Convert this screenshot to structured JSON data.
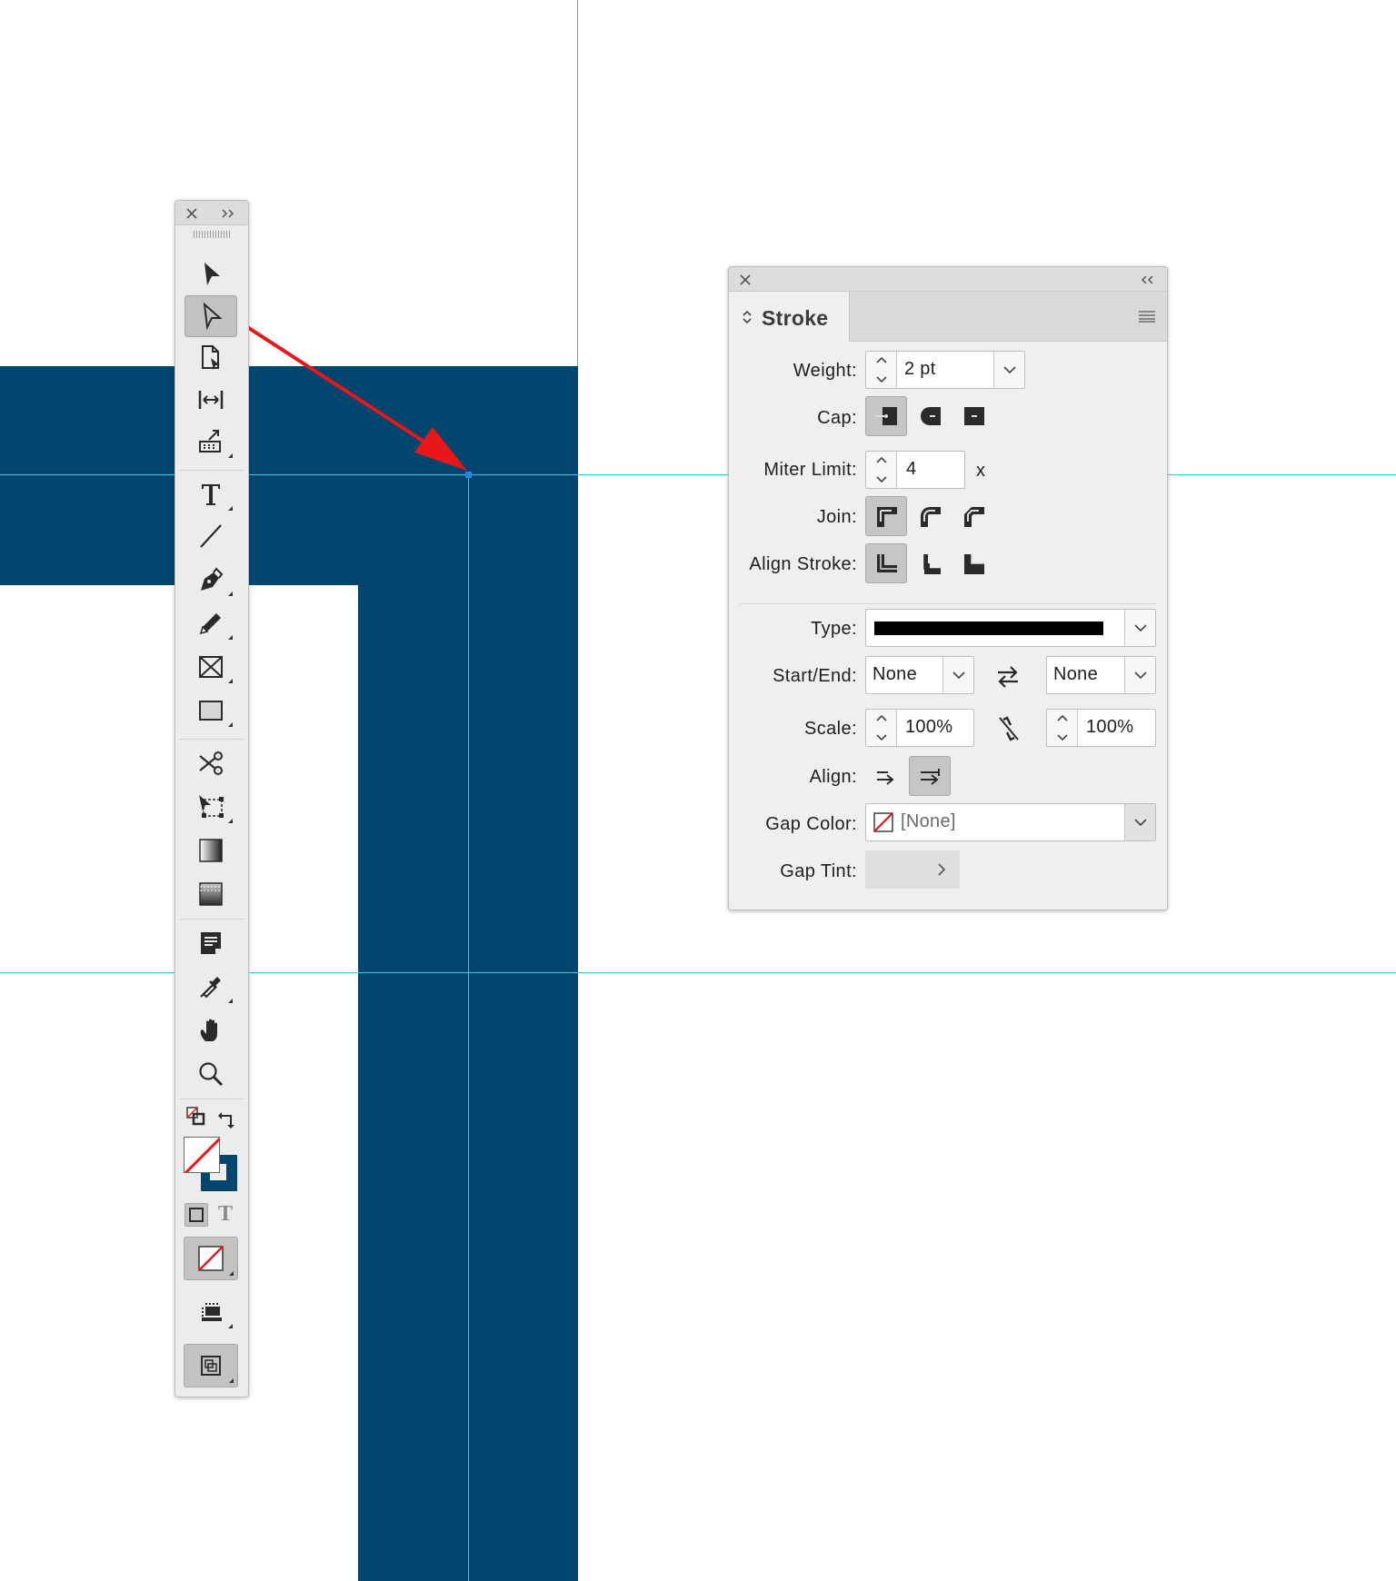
{
  "colors": {
    "artwork_fill": "#00466f",
    "guide": "#3fc6e6",
    "margin_guide": "#b37bd1",
    "annotation_arrow": "#e8171a",
    "none_swatch_slash": "#e8171a"
  },
  "toolbar": {
    "tools": [
      {
        "name": "selection-tool-icon"
      },
      {
        "name": "direct-selection-tool-icon",
        "selected": true
      },
      {
        "name": "page-tool-icon"
      },
      {
        "name": "gap-tool-icon"
      },
      {
        "name": "content-collector-tool-icon"
      },
      {
        "name": "type-tool-icon"
      },
      {
        "name": "line-tool-icon"
      },
      {
        "name": "pen-tool-icon"
      },
      {
        "name": "pencil-tool-icon"
      },
      {
        "name": "rectangle-frame-tool-icon"
      },
      {
        "name": "rectangle-tool-icon"
      },
      {
        "name": "scissors-tool-icon"
      },
      {
        "name": "free-transform-tool-icon"
      },
      {
        "name": "gradient-swatch-tool-icon"
      },
      {
        "name": "gradient-feather-tool-icon"
      },
      {
        "name": "note-tool-icon"
      },
      {
        "name": "eyedropper-tool-icon"
      },
      {
        "name": "hand-tool-icon"
      },
      {
        "name": "zoom-tool-icon"
      }
    ],
    "fill_stroke": {
      "fill": "None",
      "stroke": "#00466f"
    },
    "formatting_text_glyph": "T"
  },
  "stroke_panel": {
    "title": "Stroke",
    "weight": {
      "label": "Weight:",
      "value": "2 pt"
    },
    "cap": {
      "label": "Cap:",
      "options": [
        "butt-cap-icon",
        "round-cap-icon",
        "projecting-cap-icon"
      ],
      "selected": "butt-cap-icon"
    },
    "miter_limit": {
      "label": "Miter Limit:",
      "value": "4",
      "unit": "x"
    },
    "join": {
      "label": "Join:",
      "options": [
        "miter-join-icon",
        "round-join-icon",
        "bevel-join-icon"
      ],
      "selected": "miter-join-icon"
    },
    "align_stroke": {
      "label": "Align Stroke:",
      "options": [
        "align-center-icon",
        "align-inside-icon",
        "align-outside-icon"
      ],
      "selected": "align-center-icon"
    },
    "type": {
      "label": "Type:",
      "value": "solid-line"
    },
    "start_end": {
      "label": "Start/End:",
      "start": "None",
      "end": "None"
    },
    "scale": {
      "label": "Scale:",
      "start": "100%",
      "end": "100%"
    },
    "align": {
      "label": "Align:",
      "options": [
        "extend-tip-icon",
        "place-tip-icon"
      ],
      "selected": "place-tip-icon"
    },
    "gap_color": {
      "label": "Gap Color:",
      "value": "[None]"
    },
    "gap_tint": {
      "label": "Gap Tint:",
      "value": ""
    }
  }
}
